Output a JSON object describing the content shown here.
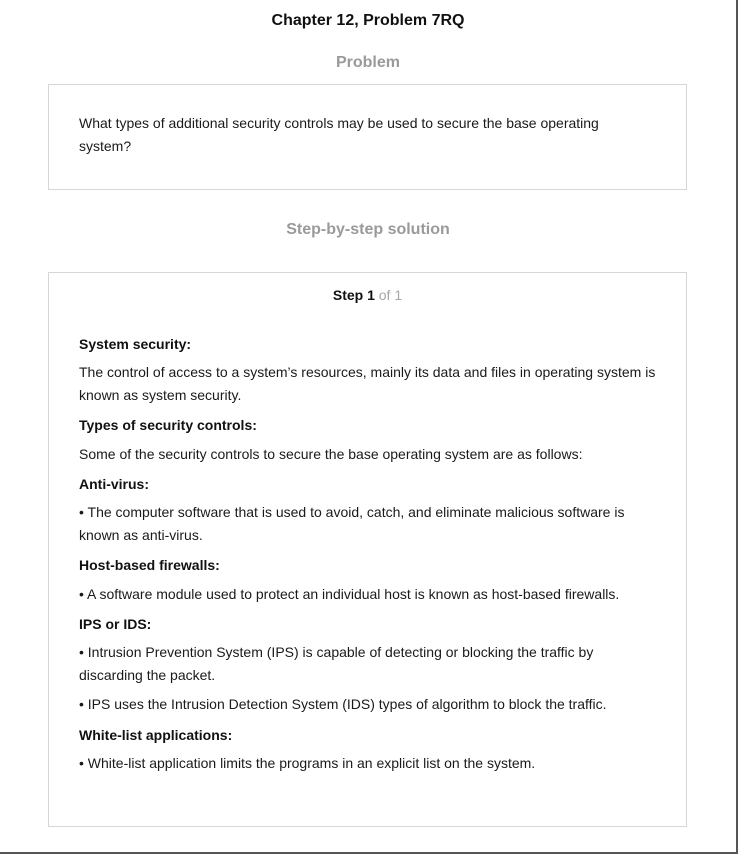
{
  "page": {
    "chapter_title": "Chapter 12, Problem 7RQ",
    "problem_heading": "Problem",
    "solution_heading": "Step-by-step solution"
  },
  "problem": {
    "text": "What types of additional security controls may be used to secure the base operating system?"
  },
  "solution": {
    "step_word": "Step 1",
    "step_of": " of 1",
    "sections": [
      {
        "heading": "System security:",
        "paragraphs": [
          "The control of access to a system’s resources, mainly its data and files in operating system is known as system security."
        ]
      },
      {
        "heading": "Types of security controls:",
        "paragraphs": [
          "Some of the security controls to secure the base operating system are as follows:"
        ]
      },
      {
        "heading": "Anti-virus:",
        "paragraphs": [
          "• The computer software that is used to avoid, catch, and eliminate malicious software is known as anti-virus."
        ]
      },
      {
        "heading": "Host-based firewalls:",
        "paragraphs": [
          "• A software module used to protect an individual host is known as host-based firewalls."
        ]
      },
      {
        "heading": "IPS or IDS:",
        "paragraphs": [
          "• Intrusion Prevention System (IPS) is capable of detecting or blocking the traffic by discarding the packet.",
          "• IPS uses the Intrusion Detection System (IDS) types of algorithm to block the traffic."
        ]
      },
      {
        "heading": "White-list applications:",
        "paragraphs": [
          "• White-list application limits the programs in an explicit list on the system."
        ]
      }
    ]
  }
}
